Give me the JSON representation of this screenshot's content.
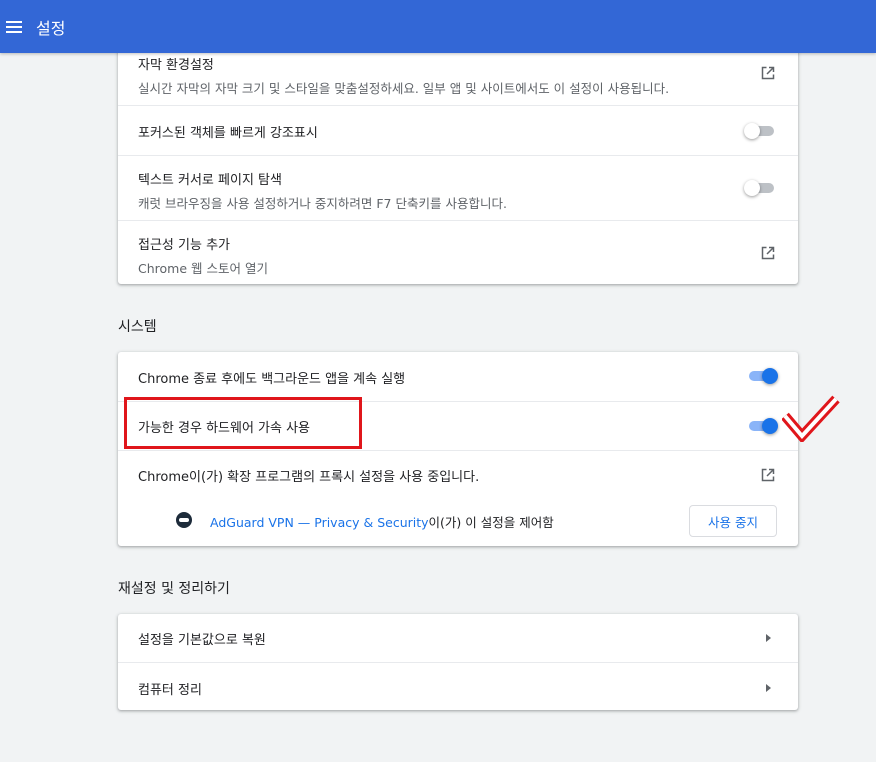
{
  "header": {
    "title": "설정",
    "menu_icon": "hamburger-menu-icon",
    "color": "#3367d6"
  },
  "accessibility": {
    "captions": {
      "label": "자막 환경설정",
      "sub": "실시간 자막의 자막 크기 및 스타일을 맞춤설정하세요. 일부 앱 및 사이트에서도 이 설정이 사용됩니다.",
      "icon": "open-in-new-icon"
    },
    "focus_highlight": {
      "label": "포커스된 객체를 빠르게 강조표시",
      "enabled": false
    },
    "caret_browsing": {
      "label": "텍스트 커서로 페이지 탐색",
      "sub": "캐럿 브라우징을 사용 설정하거나 중지하려면 F7 단축키를 사용합니다.",
      "enabled": false
    },
    "add_features": {
      "label": "접근성 기능 추가",
      "sub": "Chrome 웹 스토어 열기",
      "icon": "open-in-new-icon"
    }
  },
  "system": {
    "title": "시스템",
    "background_apps": {
      "label": "Chrome 종료 후에도 백그라운드 앱을 계속 실행",
      "enabled": true
    },
    "hardware_accel": {
      "label": "가능한 경우 하드웨어 가속 사용",
      "enabled": true
    },
    "proxy": {
      "label": "Chrome이(가) 확장 프로그램의 프록시 설정을 사용 중입니다.",
      "icon": "open-in-new-icon"
    },
    "adguard": {
      "link": "AdGuard VPN — Privacy & Security",
      "suffix": "이(가) 이 설정을 제어함",
      "button": "사용 중지",
      "icon": "adguard-icon"
    }
  },
  "reset": {
    "title": "재설정 및 정리하기",
    "restore": {
      "label": "설정을 기본값으로 복원"
    },
    "cleanup": {
      "label": "컴퓨터 정리"
    }
  },
  "annotations": {
    "highlight_color": "#e0161b"
  }
}
